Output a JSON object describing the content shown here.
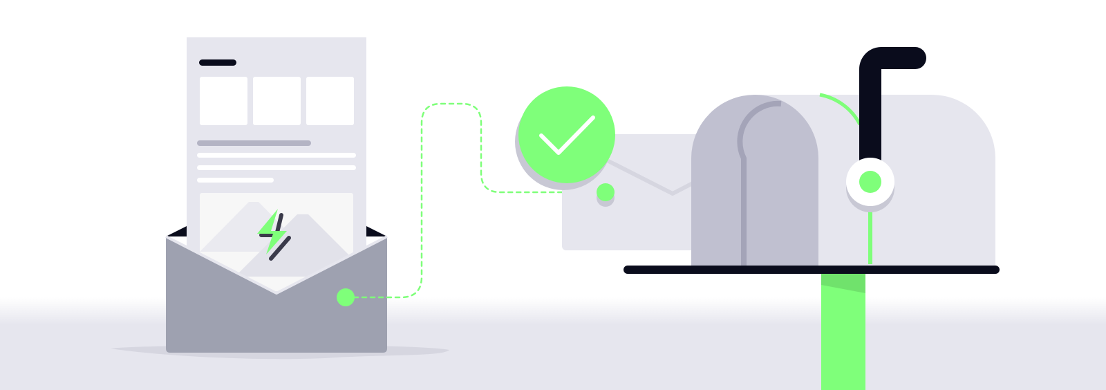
{
  "illustration": {
    "colors": {
      "accent_green": "#7fff7a",
      "accent_green_dark": "#70e26c",
      "ink": "#0a0c1c",
      "paper": "#e6e6ee",
      "envelope_gray": "#9ea1b0",
      "mailbox_body": "#e6e6ee",
      "mailbox_shade": "#c0c0d0",
      "ground": "#e6e6ee"
    },
    "icons": {
      "status": "checkmark-icon",
      "speed": "lightning-bolt-icon",
      "image_placeholder": "mountain-image-icon",
      "letter": "closed-envelope-icon",
      "open_letter": "open-envelope-icon",
      "mailbox": "mailbox-icon",
      "flag": "mailbox-flag-icon"
    },
    "delivery_status": "sent"
  }
}
